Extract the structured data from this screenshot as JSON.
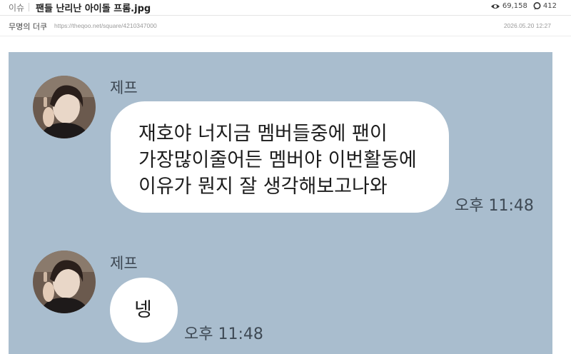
{
  "post": {
    "category": "이슈",
    "title": "팬들 난리난 아이돌 프롬.jpg",
    "views": "69,158",
    "comments": "412",
    "author": "무명의 더쿠",
    "url": "https://theqoo.net/square/4210347000",
    "date": "2026.05.20 12:27"
  },
  "chat": {
    "background": "#a9bdce",
    "messages": [
      {
        "sender": "제프",
        "lines": [
          "재호야 너지금 멤버들중에 팬이",
          "가장많이줄어든 멤버야 이번활동에",
          "이유가 뭔지 잘 생각해보고나와"
        ],
        "time": "오후 11:48"
      },
      {
        "sender": "제프",
        "lines": [
          "넹"
        ],
        "time": "오후 11:48"
      }
    ]
  }
}
